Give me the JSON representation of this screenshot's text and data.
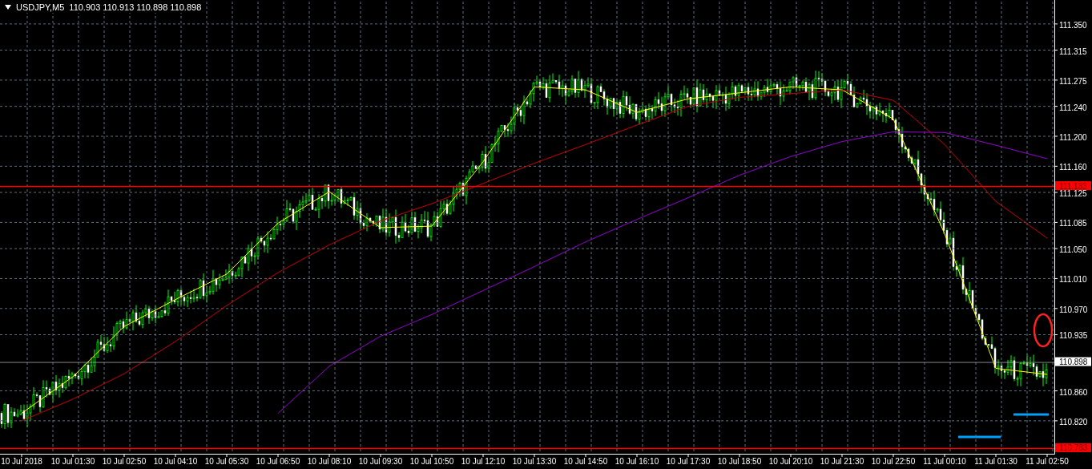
{
  "symbol_bar": {
    "symbol": "USDJPY,M5",
    "quote": "110.903 110.913 110.898 110.898"
  },
  "chart_data": {
    "type": "line",
    "grid": true,
    "categories": [
      "10 Jul 2018",
      "10 Jul 01:30",
      "10 Jul 02:50",
      "10 Jul 04:10",
      "10 Jul 05:30",
      "10 Jul 06:50",
      "10 Jul 08:10",
      "10 Jul 09:30",
      "10 Jul 10:50",
      "10 Jul 12:10",
      "10 Jul 13:30",
      "10 Jul 14:50",
      "10 Jul 16:10",
      "10 Jul 17:30",
      "10 Jul 18:50",
      "10 Jul 20:10",
      "10 Jul 21:30",
      "10 Jul 22:50",
      "11 Jul 00:10",
      "11 Jul 01:30",
      "11 Jul 02:50"
    ],
    "ylim": [
      110.776,
      111.382
    ],
    "yticks": [
      {
        "value": 111.35,
        "label": "111.350"
      },
      {
        "value": 111.315,
        "label": "111.315"
      },
      {
        "value": 111.275,
        "label": "111.275"
      },
      {
        "value": 111.24,
        "label": "111.240"
      },
      {
        "value": 111.2,
        "label": "111.200"
      },
      {
        "value": 111.16,
        "label": "111.160"
      },
      {
        "value": 111.125,
        "label": "111.125"
      },
      {
        "value": 111.085,
        "label": "111.085"
      },
      {
        "value": 111.05,
        "label": "111.050"
      },
      {
        "value": 111.01,
        "label": "111.010"
      },
      {
        "value": 110.97,
        "label": "110.970"
      },
      {
        "value": 110.935,
        "label": "110.935"
      },
      {
        "value": 110.86,
        "label": "110.860"
      },
      {
        "value": 110.82,
        "label": "110.820"
      }
    ],
    "series": [
      {
        "color": "#ffff00",
        "values": [
          110.83,
          110.879,
          110.946,
          110.982,
          111.016,
          111.084,
          111.126,
          111.078,
          111.08,
          111.166,
          111.266,
          111.262,
          111.232,
          111.25,
          111.258,
          111.266,
          111.262,
          111.223,
          111.07,
          110.89,
          110.882
        ]
      },
      {
        "color": "#c80000",
        "values": [
          110.82,
          110.849,
          110.883,
          110.926,
          110.974,
          111.018,
          111.055,
          111.087,
          111.11,
          111.137,
          111.164,
          111.189,
          111.215,
          111.24,
          111.252,
          111.257,
          111.262,
          111.248,
          111.189,
          111.113,
          111.064
        ]
      },
      {
        "color": "#9400d3",
        "values": [
          null,
          null,
          null,
          null,
          null,
          110.83,
          110.893,
          110.933,
          110.962,
          110.994,
          111.026,
          111.059,
          111.089,
          111.118,
          111.148,
          111.173,
          111.193,
          111.206,
          111.205,
          111.188,
          111.17
        ]
      }
    ],
    "ref_lines": [
      {
        "axis": "y",
        "value": 111.133,
        "label": "111.133",
        "color": "#ff0000"
      },
      {
        "axis": "y",
        "value": 110.783,
        "label": "110.783",
        "color": "#ff0000"
      },
      {
        "axis": "y",
        "value": 110.898,
        "label": "110.898",
        "color": "#c0c0c0"
      }
    ]
  }
}
